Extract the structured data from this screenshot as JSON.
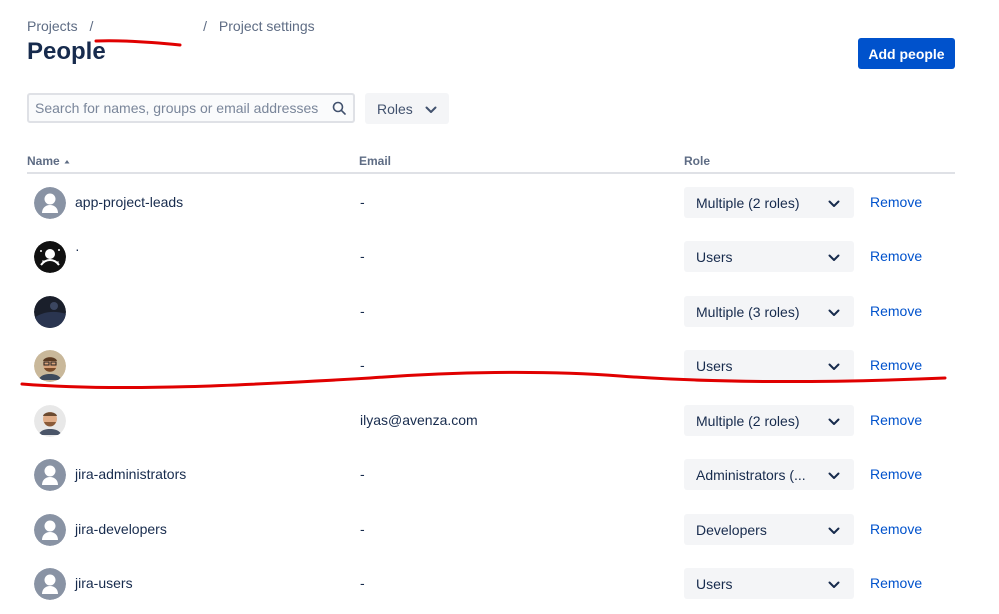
{
  "breadcrumb": {
    "root": "Projects",
    "separator": "/",
    "current": "Project settings"
  },
  "page_title": "People",
  "add_people_label": "Add people",
  "search": {
    "placeholder": "Search for names, groups or email addresses",
    "value": ""
  },
  "roles_filter_label": "Roles",
  "columns": {
    "name": "Name",
    "email": "Email",
    "role": "Role"
  },
  "remove_label": "Remove",
  "rows": [
    {
      "name": "app-project-leads",
      "email": "-",
      "role": "Multiple (2 roles)",
      "avatar": "default"
    },
    {
      "name": "·",
      "email": "-",
      "role": "Users",
      "avatar": "dark-pattern"
    },
    {
      "name": "",
      "email": "-",
      "role": "Multiple (3 roles)",
      "avatar": "dark-photo"
    },
    {
      "name": "",
      "email": "-",
      "role": "Users",
      "avatar": "photo-glasses"
    },
    {
      "name": "",
      "email": "ilyas@avenza.com",
      "role": "Multiple (2 roles)",
      "avatar": "photo-beard"
    },
    {
      "name": "jira-administrators",
      "email": "-",
      "role": "Administrators (...",
      "avatar": "default"
    },
    {
      "name": "jira-developers",
      "email": "-",
      "role": "Developers",
      "avatar": "default"
    },
    {
      "name": "jira-users",
      "email": "-",
      "role": "Users",
      "avatar": "default"
    }
  ],
  "colors": {
    "primary": "#0052CC",
    "text": "#172B4D",
    "subtle": "#5E6C84",
    "annotation": "#E00000"
  }
}
